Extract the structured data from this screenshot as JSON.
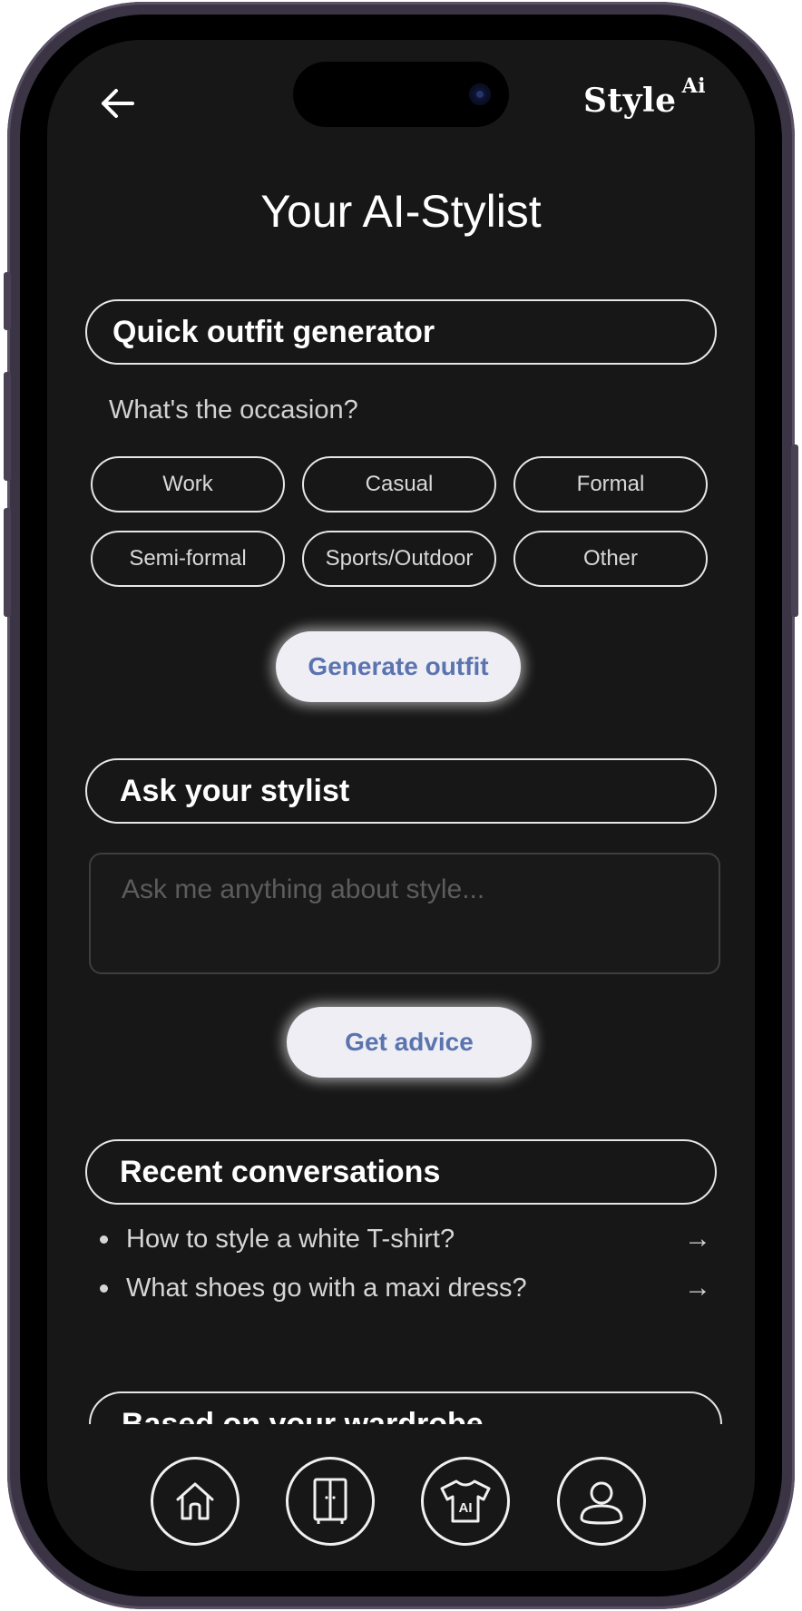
{
  "header": {
    "back_icon": "arrow-left-icon",
    "brand_main": "Style",
    "brand_sup": "Ai"
  },
  "page_title": "Your AI-Stylist",
  "quick_outfit": {
    "heading": "Quick outfit generator",
    "prompt": "What's the occasion?",
    "occasions": [
      "Work",
      "Casual",
      "Formal",
      "Semi-formal",
      "Sports/Outdoor",
      "Other"
    ],
    "generate_label": "Generate outfit"
  },
  "ask_stylist": {
    "heading": "Ask your stylist",
    "placeholder": "Ask me anything about style...",
    "advice_label": "Get advice"
  },
  "recent": {
    "heading": "Recent conversations",
    "items": [
      {
        "text": "How to style a white T-shirt?",
        "arrow": "→"
      },
      {
        "text": "What shoes go with a maxi dress?",
        "arrow": "→"
      }
    ]
  },
  "wardrobe": {
    "heading": "Based on your wardrobe"
  },
  "bottom_nav": {
    "items": [
      {
        "icon": "home-icon"
      },
      {
        "icon": "wardrobe-icon"
      },
      {
        "icon": "ai-tshirt-icon",
        "label": "AI"
      },
      {
        "icon": "profile-icon"
      }
    ]
  },
  "colors": {
    "screen_bg": "#171717",
    "accent_text": "#5b74b0",
    "button_bg": "#eeeef4",
    "frame": "#3b3444"
  }
}
